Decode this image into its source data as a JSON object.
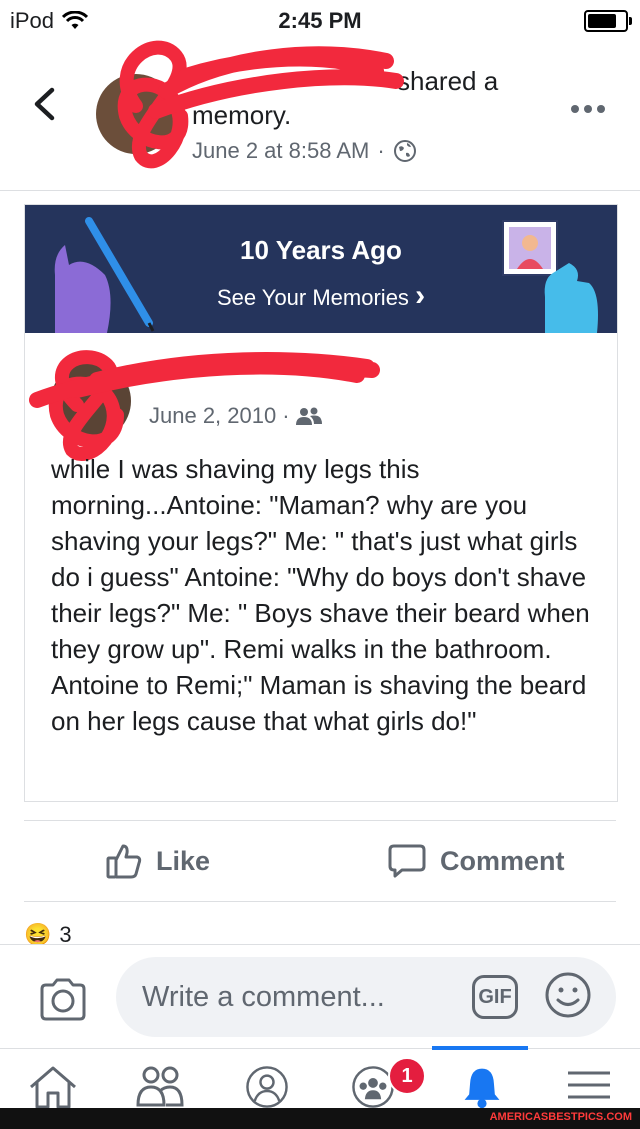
{
  "status_bar": {
    "carrier": "iPod",
    "time": "2:45 PM"
  },
  "header": {
    "back_icon": "chevron-left-icon",
    "title": "shared a memory.",
    "date": "June 2 at 8:58 AM",
    "privacy_icon": "globe-icon",
    "more_icon": "more-dots-icon"
  },
  "memory_banner": {
    "title": "10 Years Ago",
    "subtitle": "See Your Memories",
    "chevron": "›",
    "color": "#25345c"
  },
  "post": {
    "author_visible": "",
    "date": "June 2, 2010",
    "audience_icon": "friends-icon",
    "text": "while I was shaving my legs this morning...Antoine: \"Maman? why are you shaving your legs?\" Me: \" that's just what girls do i guess\"  Antoine: \"Why do boys don't shave their legs?\" Me: \" Boys shave their beard when they grow up\". Remi walks in the bathroom.  Antoine to Remi;\" Maman is shaving the beard on her legs cause that what girls do!\""
  },
  "actions": {
    "like_label": "Like",
    "comment_label": "Comment"
  },
  "reactions": {
    "emoji": "😆",
    "count": "3"
  },
  "comment_bar": {
    "placeholder": "Write a comment...",
    "gif_label": "GIF"
  },
  "tab_bar": {
    "items": [
      "home-icon",
      "friends-icon",
      "profile-icon",
      "groups-icon",
      "notifications-icon",
      "menu-icon"
    ],
    "active": "notifications-icon",
    "groups_badge": "1",
    "accent": "#1877f2"
  },
  "watermark": {
    "text": "AMERICASBESTPICS.COM"
  },
  "colors": {
    "scribble": "#f2293d",
    "secondary_text": "#606770"
  }
}
